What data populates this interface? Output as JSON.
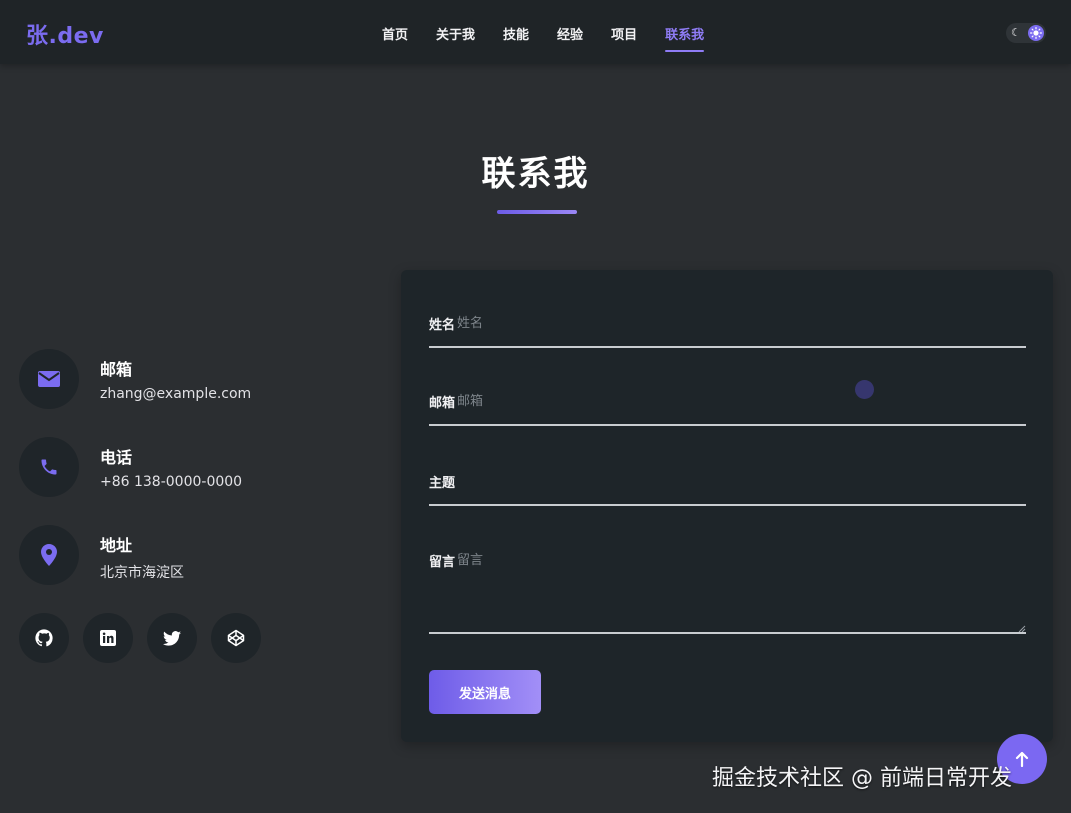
{
  "header": {
    "logo": "张.dev",
    "nav": [
      {
        "label": "首页",
        "active": false
      },
      {
        "label": "关于我",
        "active": false
      },
      {
        "label": "技能",
        "active": false
      },
      {
        "label": "经验",
        "active": false
      },
      {
        "label": "项目",
        "active": false
      },
      {
        "label": "联系我",
        "active": true
      }
    ],
    "theme_toggle_icons": [
      "moon-icon",
      "sun-icon"
    ]
  },
  "section": {
    "title": "联系我"
  },
  "contact_info": [
    {
      "icon": "envelope-icon",
      "label": "邮箱",
      "value": "zhang@example.com"
    },
    {
      "icon": "phone-icon",
      "label": "电话",
      "value": "+86 138-0000-0000"
    },
    {
      "icon": "location-pin-icon",
      "label": "地址",
      "value": "北京市海淀区"
    }
  ],
  "social_links": [
    "github-icon",
    "linkedin-icon",
    "twitter-icon",
    "codepen-icon"
  ],
  "form": {
    "name": {
      "label": "姓名",
      "placeholder": "姓名",
      "value": ""
    },
    "email": {
      "label": "邮箱",
      "placeholder": "邮箱",
      "value": ""
    },
    "subject": {
      "label": "主题",
      "placeholder": "",
      "value": ""
    },
    "message": {
      "label": "留言",
      "placeholder": "留言",
      "value": ""
    },
    "submit_label": "发送消息"
  },
  "back_to_top_icon": "arrow-up-icon",
  "watermark": "掘金技术社区 @ 前端日常开发",
  "colors": {
    "accent": "#7b6cf0",
    "background": "#2b2e31",
    "card": "#1e2529",
    "header": "#1f2427"
  }
}
